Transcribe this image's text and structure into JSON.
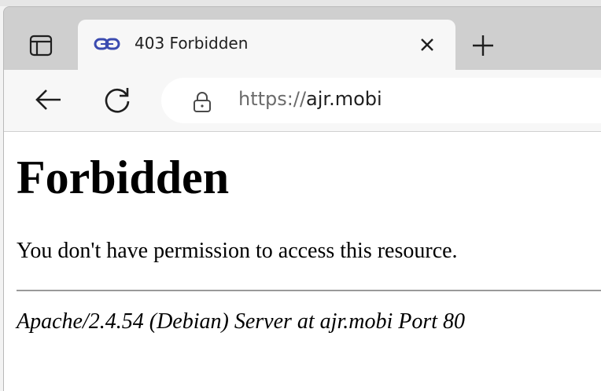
{
  "browser": {
    "tab": {
      "title": "403 Forbidden"
    },
    "address_bar": {
      "scheme": "https://",
      "host": "ajr.mobi"
    }
  },
  "page": {
    "heading": "Forbidden",
    "message": "You don't have permission to access this resource.",
    "server_signature": "Apache/2.4.54 (Debian) Server at ajr.mobi Port 80"
  },
  "icons": {
    "tab_actions": "tab-actions-icon",
    "favicon": "link-favicon-icon",
    "tab_close": "close-icon",
    "new_tab": "plus-icon",
    "back": "back-arrow-icon",
    "reload": "reload-icon",
    "lock": "lock-icon"
  },
  "colors": {
    "tabstrip_bg": "#cfcfcf",
    "tab_bg": "#f7f7f7",
    "favicon": "#3b4bb0",
    "url_scheme": "#6b6b6b"
  }
}
